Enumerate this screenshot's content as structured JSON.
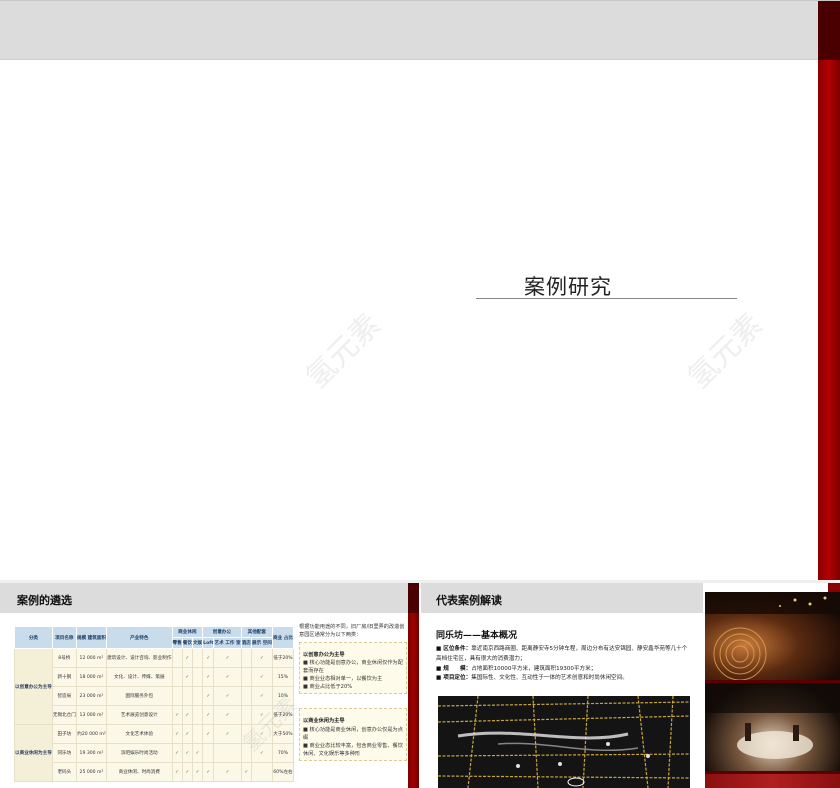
{
  "top_slide": {
    "title": "案例研究",
    "watermark": "氢元素"
  },
  "bottom_left": {
    "title": "案例的遴选",
    "table": {
      "group_headers": [
        "商业休闲",
        "创意办公",
        "其他配套"
      ],
      "columns": [
        "分类",
        "项目名称",
        "规模\n建筑面积",
        "产业特色",
        "零售",
        "餐饮",
        "文娱",
        "Loft",
        "艺术\n工作\n室",
        "酒店",
        "展示\n空间",
        "商业\n占比"
      ],
      "rows": [
        {
          "cat": "以创意办公为主导",
          "name": "8号桥",
          "area": "12 000 m²",
          "feature": "建筑设计、设计咨询、影业制作",
          "retail": "",
          "food": "✓",
          "ent": "",
          "loft": "✓",
          "art": "✓",
          "hotel": "",
          "show": "✓",
          "ratio": "低于20%"
        },
        {
          "cat": "",
          "name": "新十钢",
          "area": "18 000 m²",
          "feature": "文化、设计、传媒、策展",
          "retail": "",
          "food": "✓",
          "ent": "",
          "loft": "✓",
          "art": "✓",
          "hotel": "",
          "show": "✓",
          "ratio": "15%"
        },
        {
          "cat": "",
          "name": "智造局",
          "area": "23 000 m²",
          "feature": "国际服务外包",
          "retail": "",
          "food": "",
          "ent": "",
          "loft": "✓",
          "art": "✓",
          "hotel": "",
          "show": "✓",
          "ratio": "10%"
        },
        {
          "cat": "",
          "name": "无锡北仓门",
          "area": "13 000 m²",
          "feature": "艺术展览创意设计",
          "retail": "✓",
          "food": "✓",
          "ent": "",
          "loft": "✓",
          "art": "✓",
          "hotel": "",
          "show": "✓",
          "ratio": "低于20%"
        },
        {
          "cat": "以商业休闲为主导",
          "name": "田子坊",
          "area": "约20 000 m²",
          "feature": "文化艺术体验",
          "retail": "✓",
          "food": "✓",
          "ent": "",
          "loft": "✓",
          "art": "✓",
          "hotel": "",
          "show": "✓",
          "ratio": "大于50%"
        },
        {
          "cat": "",
          "name": "同乐坊",
          "area": "19 300 m²",
          "feature": "滨吧娱乐时尚活动",
          "retail": "✓",
          "food": "✓",
          "ent": "✓",
          "loft": "",
          "art": "",
          "hotel": "",
          "show": "✓",
          "ratio": "70%"
        },
        {
          "cat": "",
          "name": "老码头",
          "area": "25 000 m²",
          "feature": "商业休闲、时尚消费",
          "retail": "✓",
          "food": "✓",
          "ent": "✓",
          "loft": "✓",
          "art": "✓",
          "hotel": "✓",
          "show": "",
          "ratio": "60%左右"
        }
      ]
    },
    "note_intro": "根据功能用途的不同，旧厂房/旧里弄的改造创意园区通常分为以下两类：",
    "note_a_title": "以创意办公为主导",
    "note_a_items": [
      "■ 核心功能是创意办公，商业休闲仅作为配套而存在",
      "■ 商业业态相对单一，以餐饮为主",
      "■ 商业占比低于20%"
    ],
    "note_b_title": "以商业休闲为主导",
    "note_b_items": [
      "■ 核心功能是商业休闲，创意办公仅是为点缀",
      "■ 商业业态比较丰富，包含商业零售、餐饮休闲、文化娱乐等多种形"
    ]
  },
  "bottom_right": {
    "title": "代表案例解读",
    "subtitle": "同乐坊——基本概况",
    "lines": [
      {
        "label": "■ 区位条件：",
        "text": "靠近南京西路商圈、距离静安寺5分钟车程，周边分布有达安锦园、静安鑫华苑等几十个高档住宅区，具有很大的消费潜力；"
      },
      {
        "label": "■ 规　　模：",
        "text": "占地面积10000平方米，建筑面积19300平方米；"
      },
      {
        "label": "■ 项目定位：",
        "text": "集国际性、文化性、互动性于一体的艺术创意和时尚休闲空间。"
      }
    ]
  },
  "colors": {
    "brand_red": "#a30000",
    "header_gray": "#dcdcdc",
    "table_header": "#c8dcec",
    "table_cell": "#fbf8e8"
  }
}
